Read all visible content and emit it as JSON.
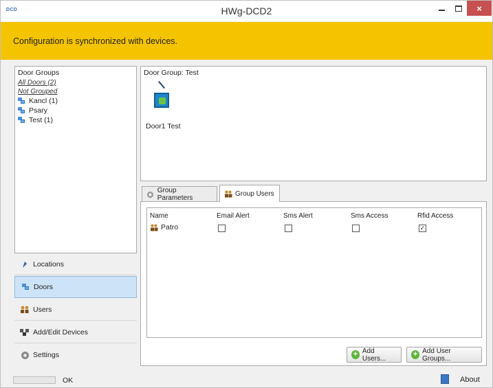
{
  "window": {
    "app_logo": "DCD",
    "title": "HWg-DCD2",
    "close_glyph": "×"
  },
  "banner": {
    "text": "Configuration is synchronized with devices.",
    "color": "#f5c400"
  },
  "door_groups": {
    "header": "Door Groups",
    "links": [
      "All Doors (2)",
      "Not Grouped"
    ],
    "items": [
      {
        "label": "Kancl (1)"
      },
      {
        "label": "Psary"
      },
      {
        "label": "Test (1)"
      }
    ]
  },
  "nav": {
    "items": [
      {
        "label": "Locations",
        "icon": "location-pin-icon"
      },
      {
        "label": "Doors",
        "icon": "doors-icon",
        "selected": true
      },
      {
        "label": "Users",
        "icon": "users-icon"
      },
      {
        "label": "Add/Edit Devices",
        "icon": "devices-icon"
      },
      {
        "label": "Settings",
        "icon": "settings-icon"
      }
    ]
  },
  "door_group": {
    "header": "Door Group: Test",
    "doors": [
      {
        "label": "Door1 Test",
        "icon": "door-lock-icon"
      }
    ]
  },
  "tabs": [
    {
      "label": "Group Parameters",
      "icon": "parameters-icon",
      "active": false
    },
    {
      "label": "Group Users",
      "icon": "group-users-icon",
      "active": true
    }
  ],
  "users_table": {
    "columns": [
      "Name",
      "Email Alert",
      "Sms Alert",
      "Sms Access",
      "Rfid Access"
    ],
    "rows": [
      {
        "name": "Patro",
        "email_alert": false,
        "sms_alert": false,
        "sms_access": false,
        "rfid_access": true
      }
    ],
    "check_glyph": "✓"
  },
  "buttons": {
    "add_users": "Add Users...",
    "add_user_groups": "Add User Groups...",
    "plus_glyph": "+"
  },
  "status": {
    "text": "OK",
    "about": "About"
  }
}
